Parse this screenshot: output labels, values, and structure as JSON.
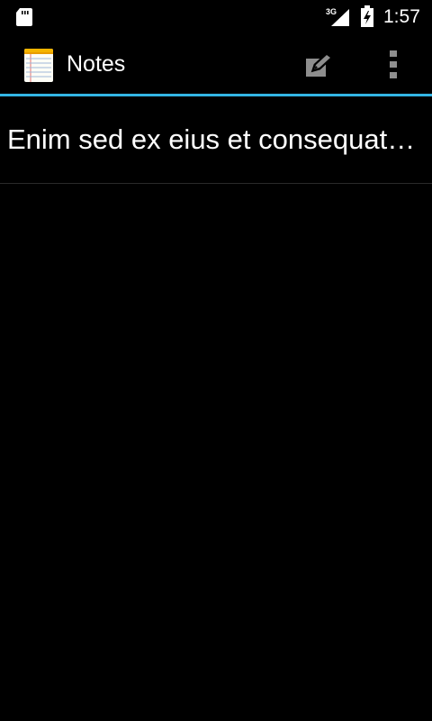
{
  "status_bar": {
    "network_type": "3G",
    "time": "1:57",
    "icons": [
      "sd-card-icon",
      "signal-icon",
      "battery-icon"
    ]
  },
  "action_bar": {
    "title": "Notes",
    "app_icon": "notepad-icon",
    "actions": [
      "edit-note-icon",
      "overflow-menu-icon"
    ],
    "divider_color": "#33b5e5"
  },
  "notes": [
    {
      "title": "Enim sed ex eius et consequat…"
    }
  ]
}
